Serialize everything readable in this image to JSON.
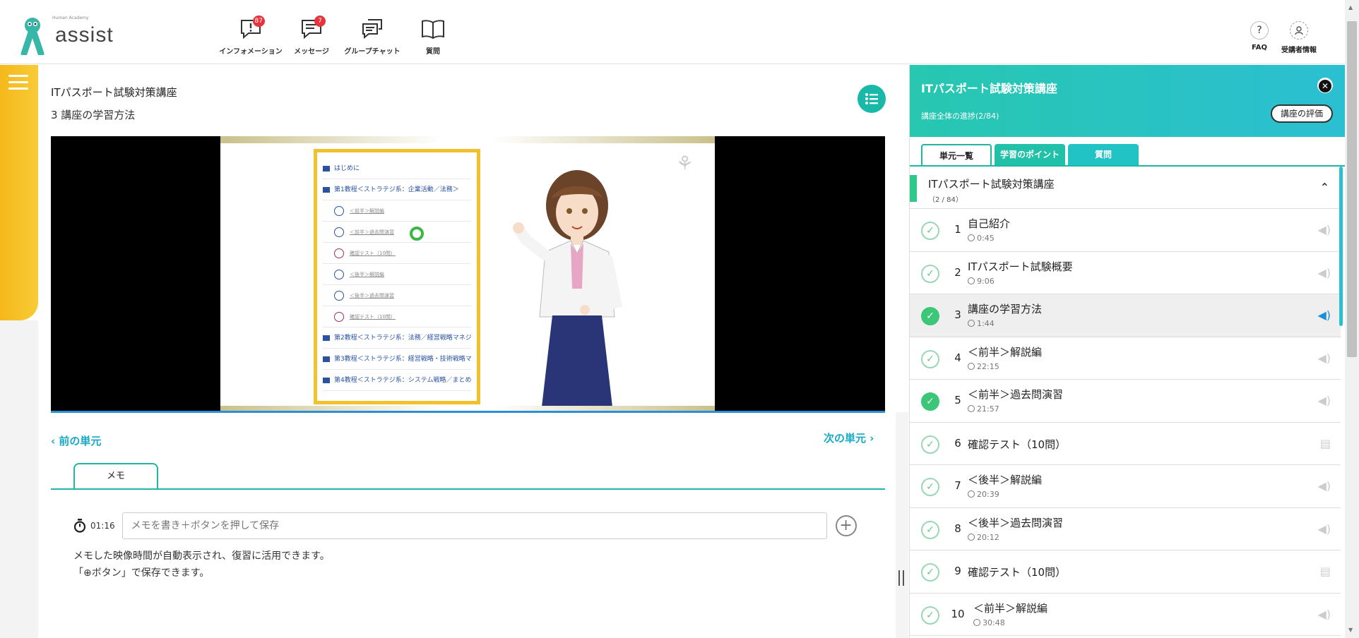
{
  "header": {
    "logo_text": "assist",
    "logo_tag": "Human Academy",
    "nav": [
      {
        "label": "インフォメーション",
        "badge": "87",
        "icon": "information-icon"
      },
      {
        "label": "メッセージ",
        "badge": "7",
        "icon": "message-icon"
      },
      {
        "label": "グループチャット",
        "badge": "",
        "icon": "group-chat-icon"
      },
      {
        "label": "質問",
        "badge": "",
        "icon": "question-book-icon"
      }
    ],
    "right": [
      {
        "label": "FAQ",
        "icon_text": "?"
      },
      {
        "label": "受講者情報",
        "icon_text": ""
      }
    ]
  },
  "main": {
    "course_title": "ITパスポート試験対策講座",
    "unit_title": "3  講座の学習方法",
    "prev_label": "前の単元",
    "next_label": "次の単元"
  },
  "video": {
    "toc": [
      {
        "text": "はじめに",
        "kind": "folder"
      },
      {
        "text": "第1教程＜ストラテジ系：企業活動／法務＞",
        "kind": "folder"
      },
      {
        "text": "＜前半＞解説編",
        "kind": "video"
      },
      {
        "text": "＜前半＞過去問演習",
        "kind": "video"
      },
      {
        "text": "確認テスト（10問）",
        "kind": "test"
      },
      {
        "text": "＜後半＞解説編",
        "kind": "video"
      },
      {
        "text": "＜後半＞過去問演習",
        "kind": "video"
      },
      {
        "text": "確認テスト（10問）",
        "kind": "test"
      },
      {
        "text": "第2教程＜ストラテジ系：法務／経営戦略マネジ",
        "kind": "folder"
      },
      {
        "text": "第3教程＜ストラテジ系：経営戦略・技術戦略マ",
        "kind": "folder"
      },
      {
        "text": "第4教程＜ストラテジ系：システム戦略／まとめ",
        "kind": "folder"
      }
    ]
  },
  "memo": {
    "tab_label": "メモ",
    "time": "01:16",
    "placeholder": "メモを書き＋ボタンを押して保存",
    "help_line1": "メモした映像時間が自動表示され、復習に活用できます。",
    "help_line2": "「⊕ボタン」で保存できます。"
  },
  "panel": {
    "title": "ITパスポート試験対策講座",
    "progress": "講座全体の進捗(2/84)",
    "eval_button": "講座の評価",
    "tabs": [
      "単元一覧",
      "学習のポイント",
      "質問"
    ],
    "section_title": "ITパスポート試験対策講座",
    "section_count": "（2 / 84）",
    "units": [
      {
        "num": "1",
        "title": "自己紹介",
        "duration": "0:45",
        "done": false,
        "type": "audio",
        "current": false
      },
      {
        "num": "2",
        "title": "ITパスポート試験概要",
        "duration": "9:06",
        "done": false,
        "type": "audio",
        "current": false
      },
      {
        "num": "3",
        "title": "講座の学習方法",
        "duration": "1:44",
        "done": true,
        "type": "audio",
        "current": true
      },
      {
        "num": "4",
        "title": "＜前半＞解説編",
        "duration": "22:15",
        "done": false,
        "type": "audio",
        "current": false
      },
      {
        "num": "5",
        "title": "＜前半＞過去問演習",
        "duration": "21:57",
        "done": true,
        "type": "audio",
        "current": false
      },
      {
        "num": "6",
        "title": "確認テスト（10問）",
        "duration": "",
        "done": false,
        "type": "test",
        "current": false
      },
      {
        "num": "7",
        "title": "＜後半＞解説編",
        "duration": "20:39",
        "done": false,
        "type": "audio",
        "current": false
      },
      {
        "num": "8",
        "title": "＜後半＞過去問演習",
        "duration": "20:12",
        "done": false,
        "type": "audio",
        "current": false
      },
      {
        "num": "9",
        "title": "確認テスト（10問）",
        "duration": "",
        "done": false,
        "type": "test",
        "current": false
      },
      {
        "num": "10",
        "title": "＜前半＞解説編",
        "duration": "30:48",
        "done": false,
        "type": "audio",
        "current": false
      }
    ]
  },
  "colors": {
    "accent": "#1fb6a4",
    "yellow": "#f5b81b",
    "badge": "#e8323c",
    "link": "#18a9c7"
  }
}
